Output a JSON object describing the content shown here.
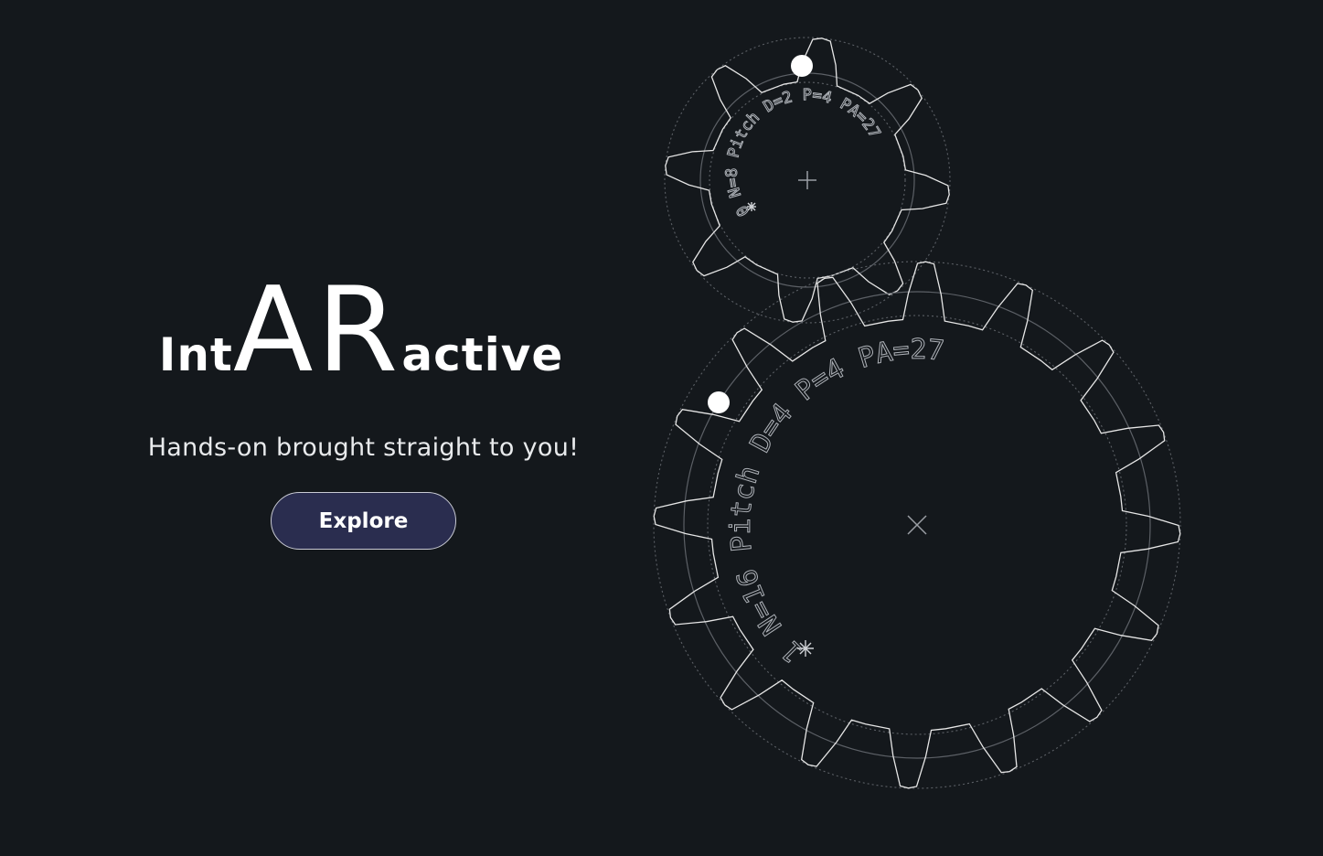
{
  "hero": {
    "title_parts": {
      "prefix": "Int",
      "emphasis": "AR",
      "suffix": "active"
    },
    "subtitle": "Hands-on brought straight to you!",
    "explore_label": "Explore"
  },
  "gears": {
    "small": {
      "label": "0 N=8 Pitch D=2 P=4 PA=27",
      "teeth": 8
    },
    "large": {
      "label": "1 N=16 Pitch D=4 P=4 PA=27",
      "teeth": 16
    }
  },
  "colors": {
    "background": "#14181c",
    "button_fill": "#2a2d4f",
    "line": "#e6e6e6"
  }
}
